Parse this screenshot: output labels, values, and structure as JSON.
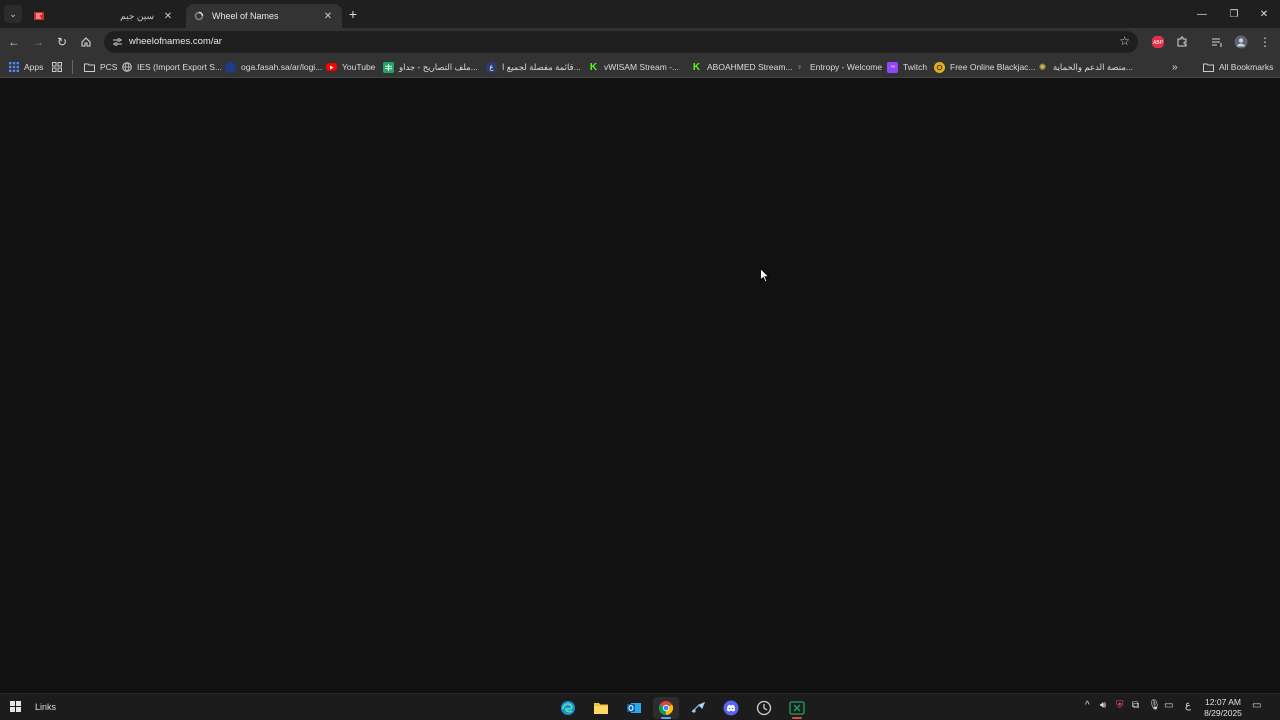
{
  "tabs": [
    {
      "title": "سين جيم",
      "active": false
    },
    {
      "title": "Wheel of Names",
      "active": true
    }
  ],
  "omnibox": {
    "url": "wheelofnames.com/ar"
  },
  "bookmarks": {
    "apps_label": "Apps",
    "items": [
      {
        "label": "PCS",
        "icon": "folder-icon"
      },
      {
        "label": "IES (Import Export S...",
        "icon": "globe-icon"
      },
      {
        "label": "oga.fasah.sa/ar/logi...",
        "icon": "fasah-icon"
      },
      {
        "label": "YouTube",
        "icon": "youtube-icon"
      },
      {
        "label": "ملف التصاريح - جداو...",
        "icon": "sheets-icon"
      },
      {
        "label": "قائمة مفصلة لجميع ا...",
        "icon": "zatca-icon"
      },
      {
        "label": "vWISAM Stream -...",
        "icon": "kick-icon"
      },
      {
        "label": "ABOAHMED Stream...",
        "icon": "kick-icon"
      },
      {
        "label": "Entropy - Welcome",
        "icon": "entropy-icon"
      },
      {
        "label": "Twitch",
        "icon": "twitch-icon"
      },
      {
        "label": "Free Online Blackjac...",
        "icon": "blackjack-icon"
      },
      {
        "label": "منصة الدعم والحماية...",
        "icon": "support-icon"
      }
    ],
    "all_bookmarks_label": "All Bookmarks"
  },
  "taskbar": {
    "links_label": "Links",
    "apps": [
      "edge-icon",
      "file-explorer-icon",
      "outlook-icon",
      "chrome-icon",
      "steam-icon",
      "discord-icon",
      "clock-app-icon",
      "excel-icon"
    ],
    "active_app": "chrome-icon",
    "ime_label": "ع",
    "time": "12:07 AM",
    "date": "8/29/2025"
  },
  "colors": {
    "page_background": "#111111",
    "chrome_toolbar": "#333333",
    "tab_strip": "#1f1f1f",
    "taskbar": "#1c1c1c",
    "youtube_red": "#ff0000",
    "kick_green": "#53fc18",
    "twitch_purple": "#9146ff"
  }
}
